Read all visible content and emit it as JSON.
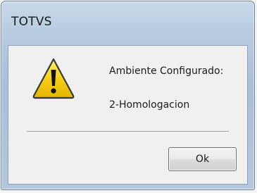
{
  "dialog": {
    "title": "TOTVS",
    "icon": "warning-icon",
    "message_line_1": "Ambiente Configurado:",
    "message_line_2": "2-Homologacion",
    "ok_label": "Ok"
  },
  "colors": {
    "title_bar": "#b9cde2",
    "client_area": "#f0f0f0",
    "warning_fill": "#f7d117",
    "warning_border": "#3a3a3a"
  }
}
